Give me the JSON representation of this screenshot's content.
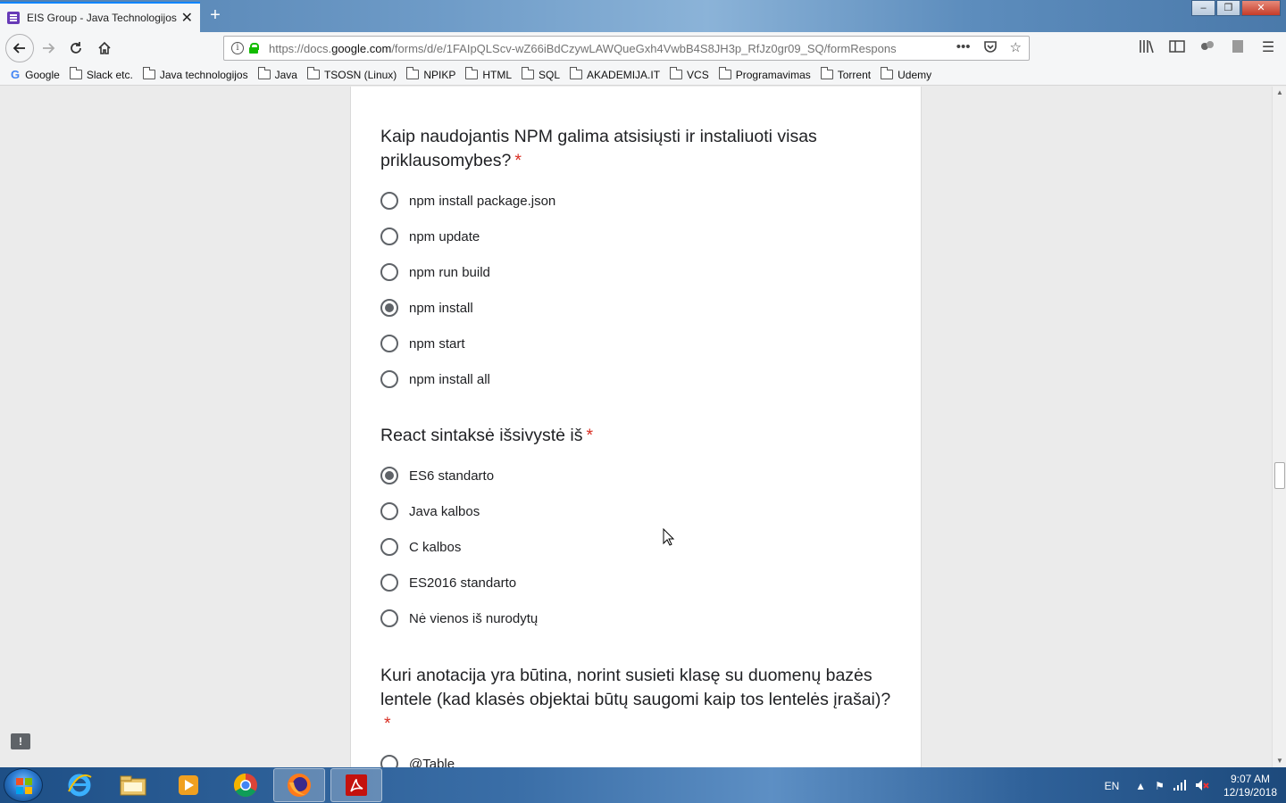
{
  "browser": {
    "tab_title": "EIS Group - Java Technologijos",
    "url_prefix": "https://docs.",
    "url_host": "google.com",
    "url_rest": "/forms/d/e/1FAIpQLScv-wZ66iBdCzywLAWQueGxh4VwbB4S8JH3p_RfJz0gr09_SQ/formRespons",
    "bookmarks": [
      "Google",
      "Slack etc.",
      "Java technologijos",
      "Java",
      "TSOSN (Linux)",
      "NPIKP",
      "HTML",
      "SQL",
      "AKADEMIJA.IT",
      "VCS",
      "Programavimas",
      "Torrent",
      "Udemy"
    ]
  },
  "form": {
    "q1": {
      "title": "Kaip naudojantis NPM galima atsisiųsti ir instaliuoti visas priklausomybes?",
      "required_mark": "*",
      "options": [
        "npm install package.json",
        "npm update",
        "npm run build",
        "npm install",
        "npm start",
        "npm install all"
      ],
      "selected_index": 3
    },
    "q2": {
      "title": "React sintaksė išsivystė iš",
      "required_mark": "*",
      "options": [
        "ES6 standarto",
        "Java kalbos",
        "C kalbos",
        "ES2016 standarto",
        "Nė vienos iš nurodytų"
      ],
      "selected_index": 0
    },
    "q3": {
      "title": "Kuri anotacija yra būtina, norint susieti klasę su duomenų bazės lentele (kad klasės objektai būtų saugomi kaip tos lentelės įrašai)?",
      "required_mark": "*",
      "options": [
        "@Table"
      ]
    }
  },
  "taskbar": {
    "lang": "EN",
    "time": "9:07 AM",
    "date": "12/19/2018"
  }
}
